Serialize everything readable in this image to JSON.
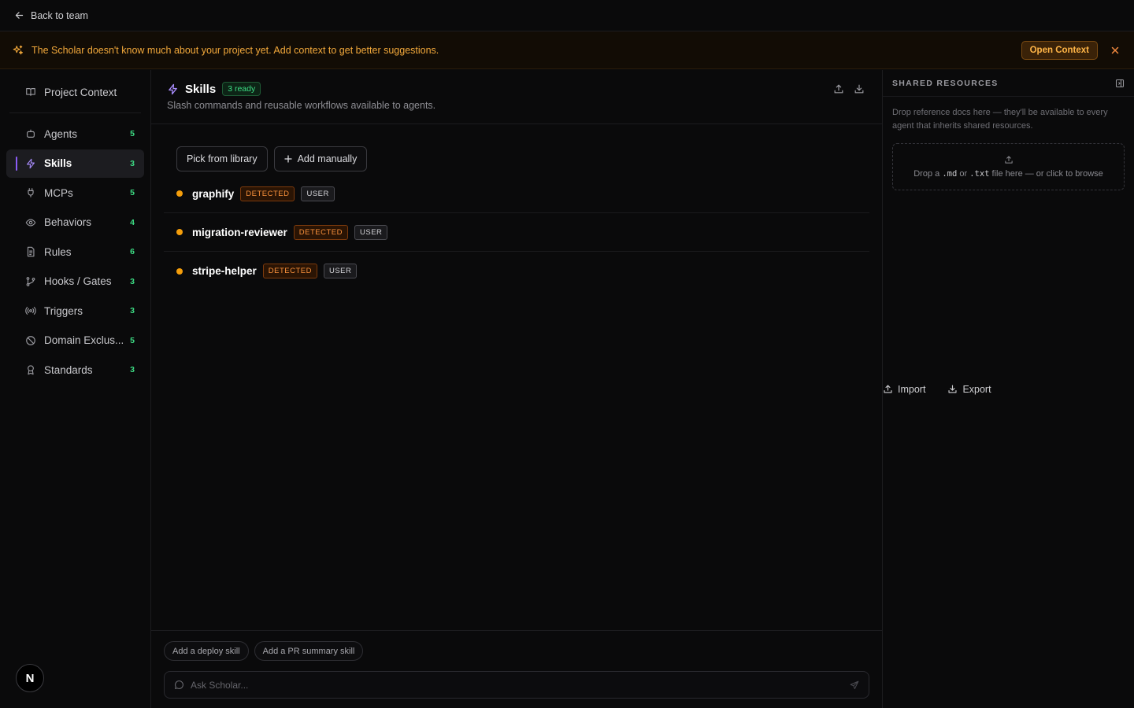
{
  "topbar": {
    "back_label": "Back to team",
    "import_label": "Import",
    "export_label": "Export"
  },
  "banner": {
    "message": "The Scholar doesn't know much about your project yet. Add context to get better suggestions.",
    "button_label": "Open Context"
  },
  "sidebar": {
    "context_label": "Project Context",
    "items": [
      {
        "label": "Agents",
        "count": "5"
      },
      {
        "label": "Skills",
        "count": "3"
      },
      {
        "label": "MCPs",
        "count": "5"
      },
      {
        "label": "Behaviors",
        "count": "4"
      },
      {
        "label": "Rules",
        "count": "6"
      },
      {
        "label": "Hooks / Gates",
        "count": "3"
      },
      {
        "label": "Triggers",
        "count": "3"
      },
      {
        "label": "Domain Exclus...",
        "count": "5"
      },
      {
        "label": "Standards",
        "count": "3"
      }
    ],
    "avatar_letter": "N"
  },
  "main": {
    "title": "Skills",
    "ready_badge": "3 ready",
    "subtitle": "Slash commands and reusable workflows available to agents.",
    "pick_label": "Pick from library",
    "add_label": "Add manually",
    "skills": [
      {
        "name": "graphify",
        "status": "DETECTED",
        "scope": "USER"
      },
      {
        "name": "migration-reviewer",
        "status": "DETECTED",
        "scope": "USER"
      },
      {
        "name": "stripe-helper",
        "status": "DETECTED",
        "scope": "USER"
      }
    ],
    "suggestions": [
      "Add a deploy skill",
      "Add a PR summary skill"
    ],
    "ask_placeholder": "Ask Scholar..."
  },
  "shared": {
    "title": "SHARED RESOURCES",
    "description": "Drop reference docs here — they'll be available to every agent that inherits shared resources.",
    "drop_prefix": "Drop a",
    "ext_md": ".md",
    "drop_or": "or",
    "ext_txt": ".txt",
    "drop_suffix": "file here — or click to browse"
  },
  "colors": {
    "accent": "#8b5cf6",
    "count": "#3ddc84",
    "warning": "#f3a93b",
    "dot": "#f59e0b"
  }
}
